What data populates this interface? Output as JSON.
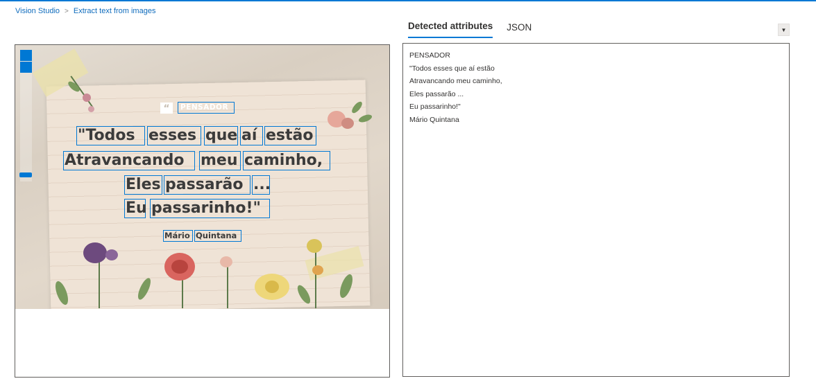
{
  "breadcrumb": {
    "home": "Vision Studio",
    "separator": ">",
    "current": "Extract text from images"
  },
  "tabs": [
    {
      "label": "Detected attributes",
      "active": true
    },
    {
      "label": "JSON",
      "active": false
    }
  ],
  "image": {
    "tag": "PENSADOR",
    "quote_lines": [
      [
        "\"Todos",
        "esses",
        "que",
        "aí",
        "estão"
      ],
      [
        "Atravancando",
        "meu",
        "caminho,"
      ],
      [
        "Eles",
        "passarão",
        "..."
      ],
      [
        "Eu",
        "passarinho!\""
      ]
    ],
    "author": [
      "Mário",
      "Quintana"
    ]
  },
  "detected_text": [
    "PENSADOR",
    "\"Todos esses que aí estão",
    "Atravancando meu caminho,",
    "Eles passarão ...",
    "Eu passarinho!\"",
    "Mário Quintana"
  ],
  "colors": {
    "accent": "#0078d4",
    "link": "#0f6cbd",
    "border": "#605e5c"
  },
  "icons": {
    "collapse": "chevron-down-icon",
    "zoom_in": "zoom-in-icon",
    "zoom_out": "zoom-out-icon"
  }
}
